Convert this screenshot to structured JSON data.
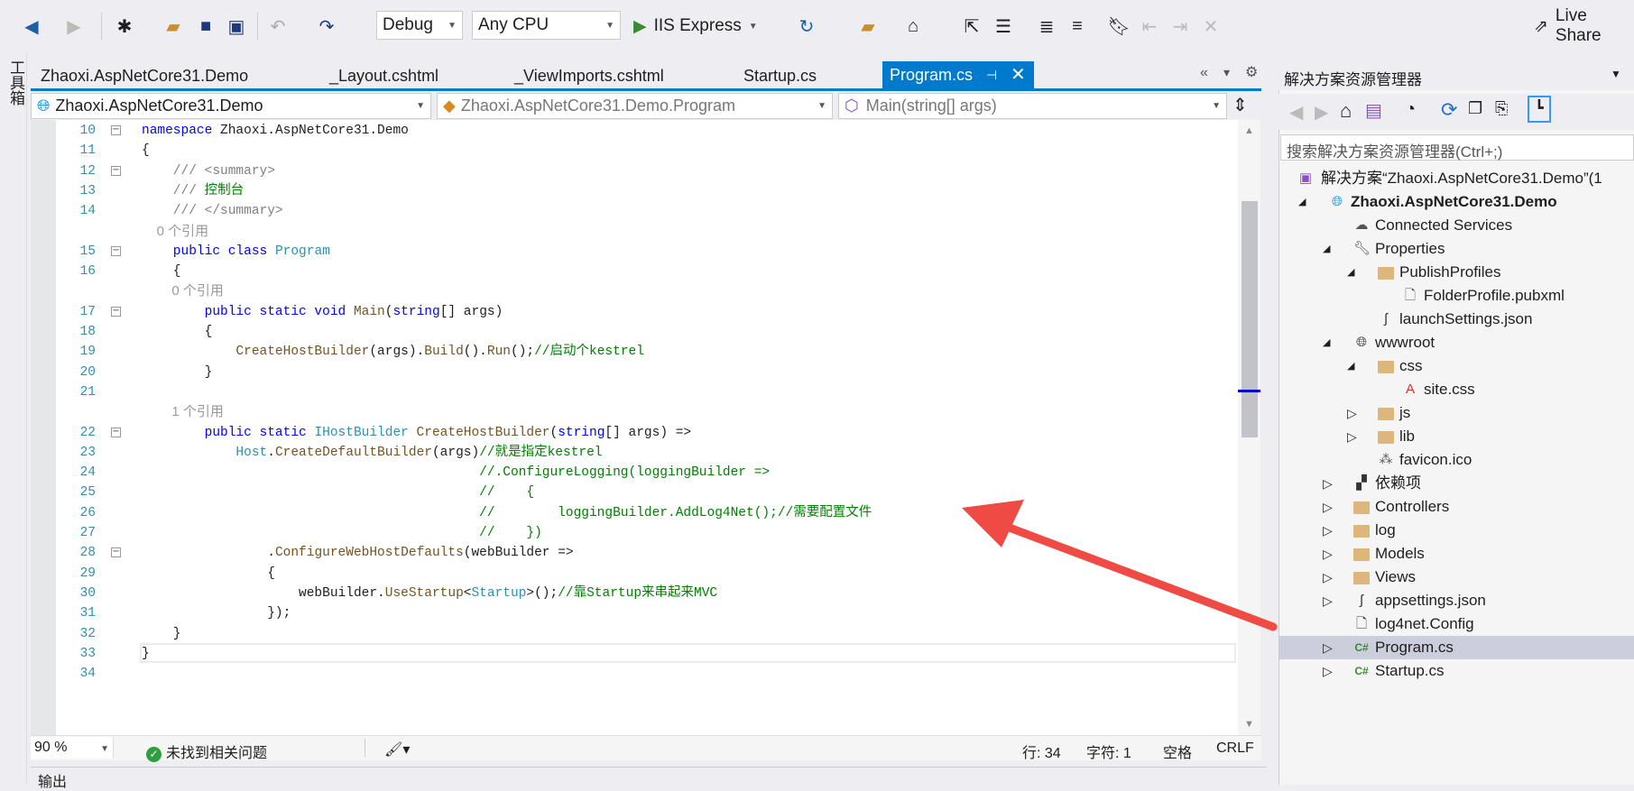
{
  "toolbar": {
    "config": "Debug",
    "platform": "Any CPU",
    "run": "IIS Express",
    "live_share": "Live Share"
  },
  "toolbox": {
    "label": "工具箱"
  },
  "tabs": [
    {
      "label": "Zhaoxi.AspNetCore31.Demo"
    },
    {
      "label": "_Layout.cshtml"
    },
    {
      "label": "_ViewImports.cshtml"
    },
    {
      "label": "Startup.cs"
    },
    {
      "label": "Program.cs",
      "active": true
    }
  ],
  "nav": {
    "project": "Zhaoxi.AspNetCore31.Demo",
    "type": "Zhaoxi.AspNetCore31.Demo.Program",
    "member": "Main(string[] args)"
  },
  "code": [
    {
      "n": "10",
      "fold": true,
      "seg": [
        [
          "kw",
          "namespace"
        ],
        [
          "pl",
          " Zhaoxi.AspNetCore31.Demo"
        ]
      ]
    },
    {
      "n": "11",
      "seg": [
        [
          "pl",
          "{"
        ]
      ]
    },
    {
      "n": "12",
      "fold": true,
      "seg": [
        [
          "xd",
          "    /// <summary>"
        ]
      ]
    },
    {
      "n": "13",
      "seg": [
        [
          "xd",
          "    /// "
        ],
        [
          "cm",
          "控制台"
        ]
      ]
    },
    {
      "n": "14",
      "seg": [
        [
          "xd",
          "    /// </summary>"
        ]
      ]
    },
    {
      "ref": "    0 个引用"
    },
    {
      "n": "15",
      "fold": true,
      "seg": [
        [
          "kw",
          "    public class "
        ],
        [
          "ty",
          "Program"
        ]
      ]
    },
    {
      "n": "16",
      "seg": [
        [
          "pl",
          "    {"
        ]
      ]
    },
    {
      "ref": "        0 个引用"
    },
    {
      "n": "17",
      "fold": true,
      "seg": [
        [
          "kw",
          "        public static void "
        ],
        [
          "me",
          "Main"
        ],
        [
          "pl",
          "("
        ],
        [
          "kw",
          "string"
        ],
        [
          "pl",
          "[] args)"
        ]
      ]
    },
    {
      "n": "18",
      "seg": [
        [
          "pl",
          "        {"
        ]
      ]
    },
    {
      "n": "19",
      "seg": [
        [
          "me",
          "            CreateHostBuilder"
        ],
        [
          "pl",
          "(args)."
        ],
        [
          "me",
          "Build"
        ],
        [
          "pl",
          "()."
        ],
        [
          "me",
          "Run"
        ],
        [
          "pl",
          "();"
        ],
        [
          "cm",
          "//启动个kestrel"
        ]
      ]
    },
    {
      "n": "20",
      "seg": [
        [
          "pl",
          "        }"
        ]
      ]
    },
    {
      "n": "21",
      "seg": []
    },
    {
      "ref": "        1 个引用"
    },
    {
      "n": "22",
      "fold": true,
      "seg": [
        [
          "kw",
          "        public static "
        ],
        [
          "ty",
          "IHostBuilder"
        ],
        [
          "me",
          " CreateHostBuilder"
        ],
        [
          "pl",
          "("
        ],
        [
          "kw",
          "string"
        ],
        [
          "pl",
          "[] args) =>"
        ]
      ]
    },
    {
      "n": "23",
      "seg": [
        [
          "ty",
          "            Host"
        ],
        [
          "pl",
          "."
        ],
        [
          "me",
          "CreateDefaultBuilder"
        ],
        [
          "pl",
          "(args)"
        ],
        [
          "cm",
          "//就是指定kestrel"
        ]
      ]
    },
    {
      "n": "24",
      "seg": [
        [
          "cm",
          "                                           //.ConfigureLogging(loggingBuilder =>"
        ]
      ]
    },
    {
      "n": "25",
      "seg": [
        [
          "cm",
          "                                           //    {"
        ]
      ]
    },
    {
      "n": "26",
      "seg": [
        [
          "cm",
          "                                           //        loggingBuilder.AddLog4Net();//需要配置文件"
        ]
      ]
    },
    {
      "n": "27",
      "seg": [
        [
          "cm",
          "                                           //    })"
        ]
      ]
    },
    {
      "n": "28",
      "fold": true,
      "seg": [
        [
          "pl",
          "                ."
        ],
        [
          "me",
          "ConfigureWebHostDefaults"
        ],
        [
          "pl",
          "(webBuilder =>"
        ]
      ]
    },
    {
      "n": "29",
      "seg": [
        [
          "pl",
          "                {"
        ]
      ]
    },
    {
      "n": "30",
      "seg": [
        [
          "pl",
          "                    webBuilder."
        ],
        [
          "me",
          "UseStartup"
        ],
        [
          "pl",
          "<"
        ],
        [
          "ty",
          "Startup"
        ],
        [
          "pl",
          ">();"
        ],
        [
          "cm",
          "//靠Startup来串起来MVC"
        ]
      ]
    },
    {
      "n": "31",
      "seg": [
        [
          "pl",
          "                });"
        ]
      ]
    },
    {
      "n": "32",
      "seg": [
        [
          "pl",
          "    }"
        ]
      ]
    },
    {
      "n": "33",
      "seg": [
        [
          "pl",
          "}"
        ]
      ]
    },
    {
      "n": "34",
      "seg": []
    }
  ],
  "status": {
    "zoom": "90 %",
    "issues": "未找到相关问题",
    "line": "行: 34",
    "col": "字符: 1",
    "spaces": "空格",
    "eol": "CRLF"
  },
  "output": {
    "title": "输出"
  },
  "solution_explorer": {
    "title": "解决方案资源管理器",
    "search_placeholder": "搜索解决方案资源管理器(Ctrl+;)",
    "items": [
      {
        "label": "解决方案“Zhaoxi.AspNetCore31.Demo”(1",
        "level": 0,
        "icon": "solution-icon",
        "exp": ""
      },
      {
        "label": "Zhaoxi.AspNetCore31.Demo",
        "level": 0,
        "icon": "web-project-icon",
        "exp": "open",
        "bold": true
      },
      {
        "label": "Connected Services",
        "level": 1,
        "icon": "connected-services-icon",
        "exp": ""
      },
      {
        "label": "Properties",
        "level": 1,
        "icon": "properties-folder-icon",
        "exp": "open"
      },
      {
        "label": "PublishProfiles",
        "level": 2,
        "icon": "folder-open-icon",
        "exp": "open"
      },
      {
        "label": "FolderProfile.pubxml",
        "level": 3,
        "icon": "pubxml-file-icon",
        "exp": ""
      },
      {
        "label": "launchSettings.json",
        "level": 2,
        "icon": "json-file-icon",
        "exp": ""
      },
      {
        "label": "wwwroot",
        "level": 1,
        "icon": "globe-icon",
        "exp": "open"
      },
      {
        "label": "css",
        "level": 2,
        "icon": "folder-open-icon",
        "exp": "open"
      },
      {
        "label": "site.css",
        "level": 3,
        "icon": "css-file-icon",
        "exp": ""
      },
      {
        "label": "js",
        "level": 2,
        "icon": "folder-icon",
        "exp": "closed"
      },
      {
        "label": "lib",
        "level": 2,
        "icon": "folder-icon",
        "exp": "closed"
      },
      {
        "label": "favicon.ico",
        "level": 2,
        "icon": "ico-file-icon",
        "exp": ""
      },
      {
        "label": "依赖项",
        "level": 1,
        "icon": "dependencies-icon",
        "exp": "closed"
      },
      {
        "label": "Controllers",
        "level": 1,
        "icon": "folder-icon",
        "exp": "closed"
      },
      {
        "label": "log",
        "level": 1,
        "icon": "folder-icon",
        "exp": "closed"
      },
      {
        "label": "Models",
        "level": 1,
        "icon": "folder-icon",
        "exp": "closed"
      },
      {
        "label": "Views",
        "level": 1,
        "icon": "folder-icon",
        "exp": "closed"
      },
      {
        "label": "appsettings.json",
        "level": 1,
        "icon": "json-file-icon",
        "exp": "closed"
      },
      {
        "label": "log4net.Config",
        "level": 1,
        "icon": "config-file-icon",
        "exp": ""
      },
      {
        "label": "Program.cs",
        "level": 1,
        "icon": "csharp-file-icon",
        "exp": "closed",
        "selected": true
      },
      {
        "label": "Startup.cs",
        "level": 1,
        "icon": "csharp-file-icon",
        "exp": "closed"
      }
    ]
  },
  "colors": {
    "accent": "#007acc",
    "annotation_arrow": "#f04a45"
  }
}
